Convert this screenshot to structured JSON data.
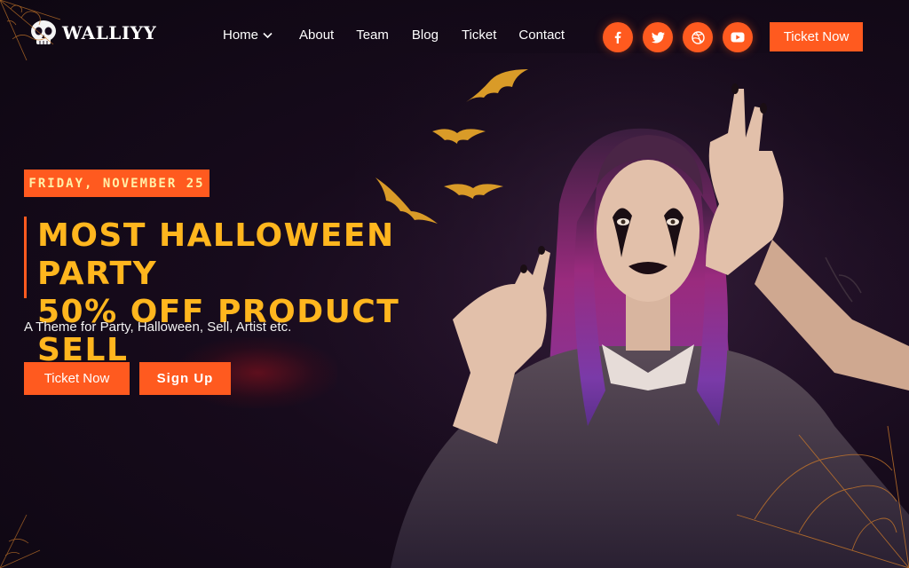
{
  "brand": {
    "logo_text": "WALLIYY",
    "icon": "skull-icon"
  },
  "nav": {
    "items": [
      {
        "label": "Home",
        "has_dropdown": true
      },
      {
        "label": "About"
      },
      {
        "label": "Team"
      },
      {
        "label": "Blog"
      },
      {
        "label": "Ticket"
      },
      {
        "label": "Contact"
      }
    ]
  },
  "social": [
    "facebook-icon",
    "twitter-icon",
    "dribbble-icon",
    "youtube-icon"
  ],
  "header_cta": {
    "label": "Ticket Now"
  },
  "hero": {
    "date": "FRIDAY, NOVEMBER 25",
    "title_line1": "MOST HALLOWEEN PARTY",
    "title_line2": "50% OFF PRODUCT SELL",
    "subtitle": "A Theme for Party, Halloween, Sell, Artist etc.",
    "primary_button": "Ticket Now",
    "secondary_button": "Sign Up"
  },
  "colors": {
    "accent": "#ff5a1f",
    "title": "#ffb61e",
    "bg": "#170b1c",
    "bat": "#d99b28"
  }
}
